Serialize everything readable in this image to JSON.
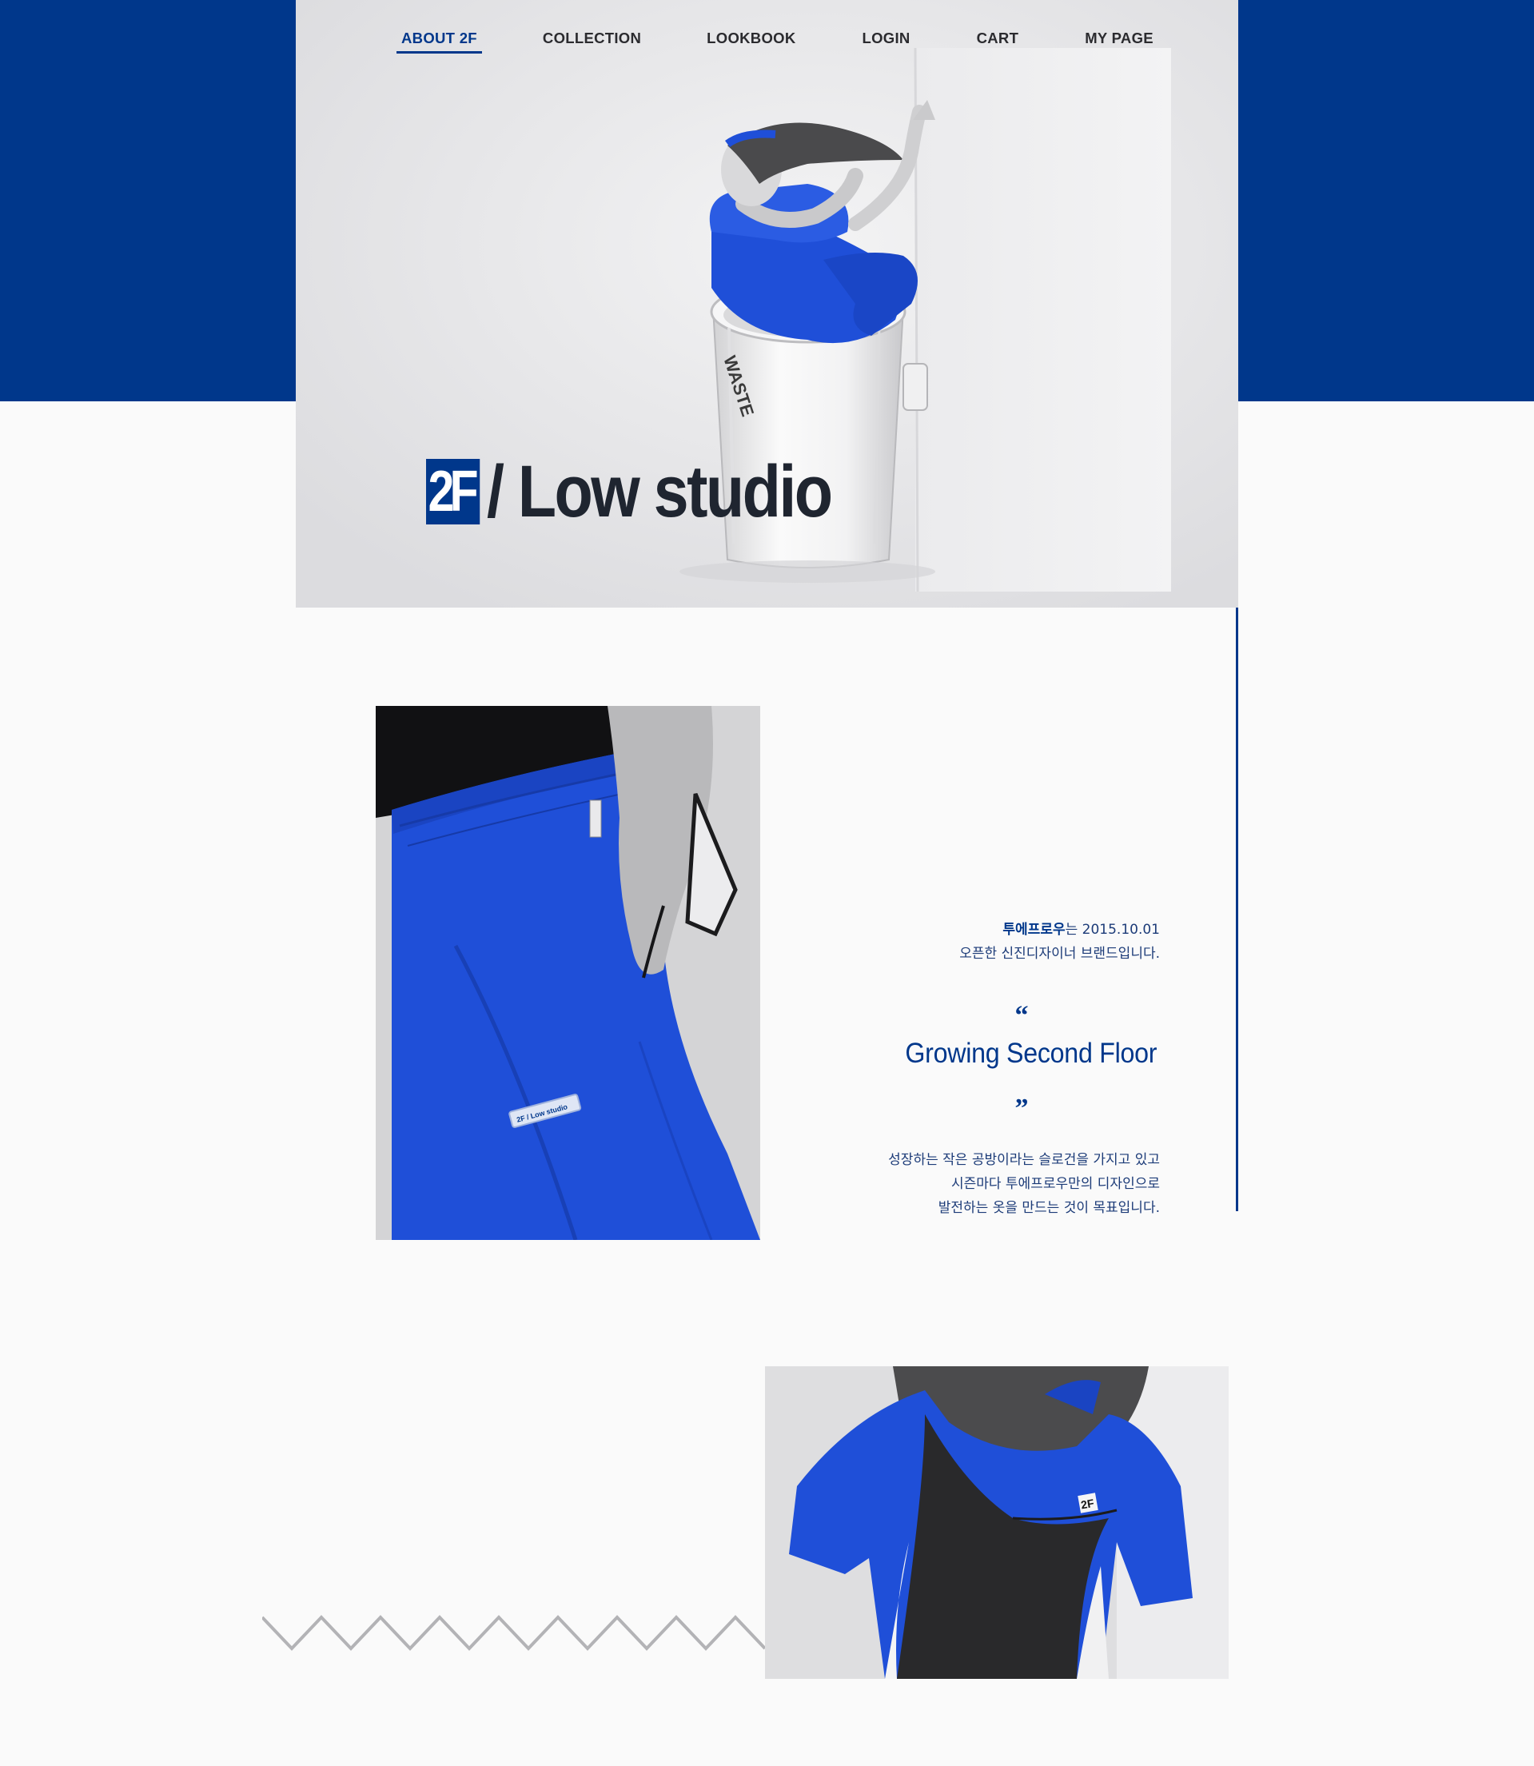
{
  "nav": {
    "items": [
      {
        "label": "ABOUT 2F",
        "active": true
      },
      {
        "label": "COLLECTION",
        "active": false
      },
      {
        "label": "LOOKBOOK",
        "active": false
      },
      {
        "label": "LOGIN",
        "active": false
      },
      {
        "label": "CART",
        "active": false
      },
      {
        "label": "MY PAGE",
        "active": false
      }
    ]
  },
  "logo": {
    "mark": "2F",
    "text": "/ Low studio"
  },
  "intro": {
    "brand_name": "투에프로우",
    "line1_rest": "는 2015.10.01",
    "line2": "오픈한 신진디자이너 브랜드입니다."
  },
  "slogan": {
    "open_quote": "“",
    "text": "Growing Second Floor",
    "close_quote": "”"
  },
  "description": {
    "line1": "성장하는 작은 공방이라는 슬로건을 가지고 있고",
    "line2": "시즌마다 투에프로우만의 디자인으로",
    "line3": "발전하는 옷을 만드는 것이 목표입니다."
  },
  "images": {
    "hero_badge": "WASTE",
    "pants_label": "2F / Low studio",
    "shirt_badge": "2F"
  },
  "colors": {
    "brand_blue": "#00378b",
    "cobalt": "#1f4fd8",
    "background": "#fafafa"
  }
}
